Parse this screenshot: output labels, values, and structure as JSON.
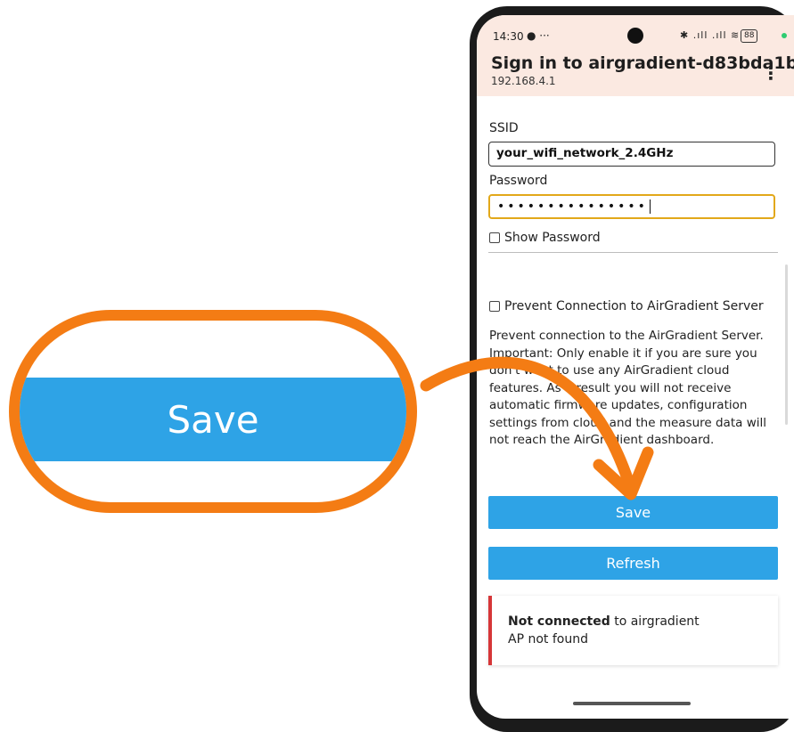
{
  "zoom": {
    "save_label": "Save"
  },
  "status_bar": {
    "time": "14:30",
    "notif": "● ···",
    "icons": "✱ .ıll .ıll ≋",
    "battery": "88"
  },
  "header": {
    "title": "Sign in to airgradient-d83bda1b...",
    "subtitle": "192.168.4.1",
    "menu_icon": "⋮"
  },
  "form": {
    "ssid_label": "SSID",
    "ssid_value": "your_wifi_network_2.4GHz",
    "password_label": "Password",
    "password_value": "•••••••••••••••",
    "show_password_label": "Show Password",
    "prevent_label": "Prevent Connection to AirGradient Server",
    "prevent_description": "Prevent connection to the AirGradient Server. Important: Only enable it if you are sure you don't want to use any AirGradient cloud features. As a result you will not receive automatic firmware updates, configuration settings from cloud and the measure data will not reach the AirGradient dashboard."
  },
  "buttons": {
    "save": "Save",
    "refresh": "Refresh"
  },
  "status": {
    "state": "Not connected",
    "target": " to airgradient",
    "detail": "AP not found"
  },
  "colors": {
    "accent_orange": "#f47c14",
    "button_blue": "#2ea3e6",
    "error_red": "#d63638",
    "header_bg": "#fbe9e1",
    "focus_yellow": "#e2a81a"
  }
}
